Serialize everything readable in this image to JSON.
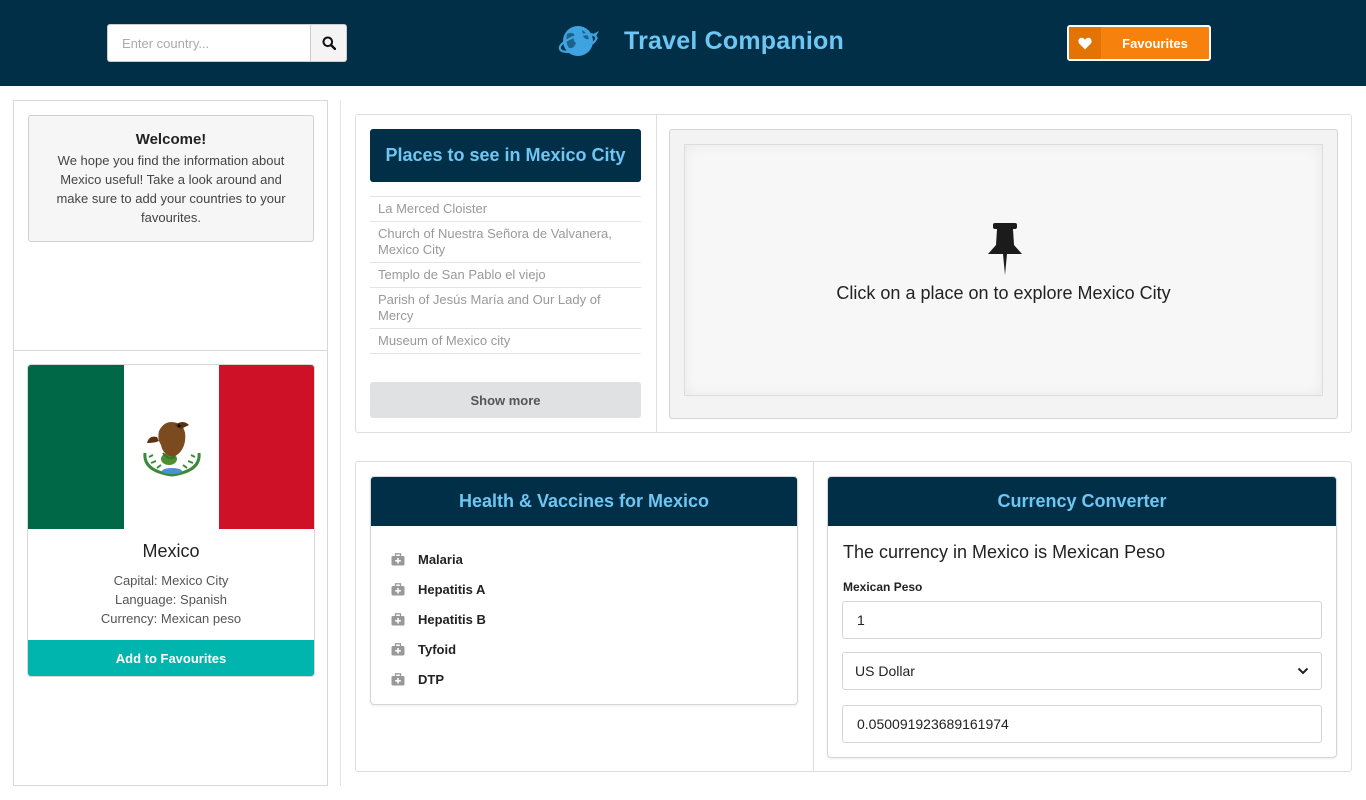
{
  "header": {
    "search": {
      "placeholder": "Enter country...",
      "value": ""
    },
    "search_icon": "search-icon",
    "logo_icon": "globe-plane-icon",
    "app_title": "Travel Companion",
    "favourites_label": "Favourites",
    "favourites_icon": "heart-icon"
  },
  "welcome": {
    "title": "Welcome!",
    "text": "We hope you find the information about Mexico useful! Take a look around and make sure to add your countries to your favourites."
  },
  "country": {
    "name": "Mexico",
    "capital": "Capital: Mexico City",
    "language": "Language: Spanish",
    "currency": "Currency: Mexican peso",
    "add_button": "Add to Favourites",
    "flag_colors": [
      "#006847",
      "#ffffff",
      "#ce1126"
    ]
  },
  "places": {
    "title": "Places to see in Mexico City",
    "items": [
      "La Merced Cloister",
      "Church of Nuestra Señora de Valvanera, Mexico City",
      "Templo de San Pablo el viejo",
      "Parish of Jesús María and Our Lady of Mercy",
      "Museum of Mexico city"
    ],
    "show_more": "Show more",
    "explore_icon": "pushpin-icon",
    "explore_text": "Click on a place on to explore Mexico City"
  },
  "health": {
    "title": "Health & Vaccines for Mexico",
    "item_icon": "medkit-icon",
    "vaccines": [
      "Malaria",
      "Hepatitis A",
      "Hepatitis B",
      "Tyfoid",
      "DTP"
    ]
  },
  "currency": {
    "title": "Currency Converter",
    "description": "The currency in Mexico is Mexican Peso",
    "from_label": "Mexican Peso",
    "amount": "1",
    "to_currency": "US Dollar",
    "result": "0.050091923689161974"
  },
  "colors": {
    "header_bg": "#012f48",
    "accent_text": "#6fc6f3",
    "favourites_orange": "#f6820d",
    "add_fav_teal": "#00b5ad"
  }
}
